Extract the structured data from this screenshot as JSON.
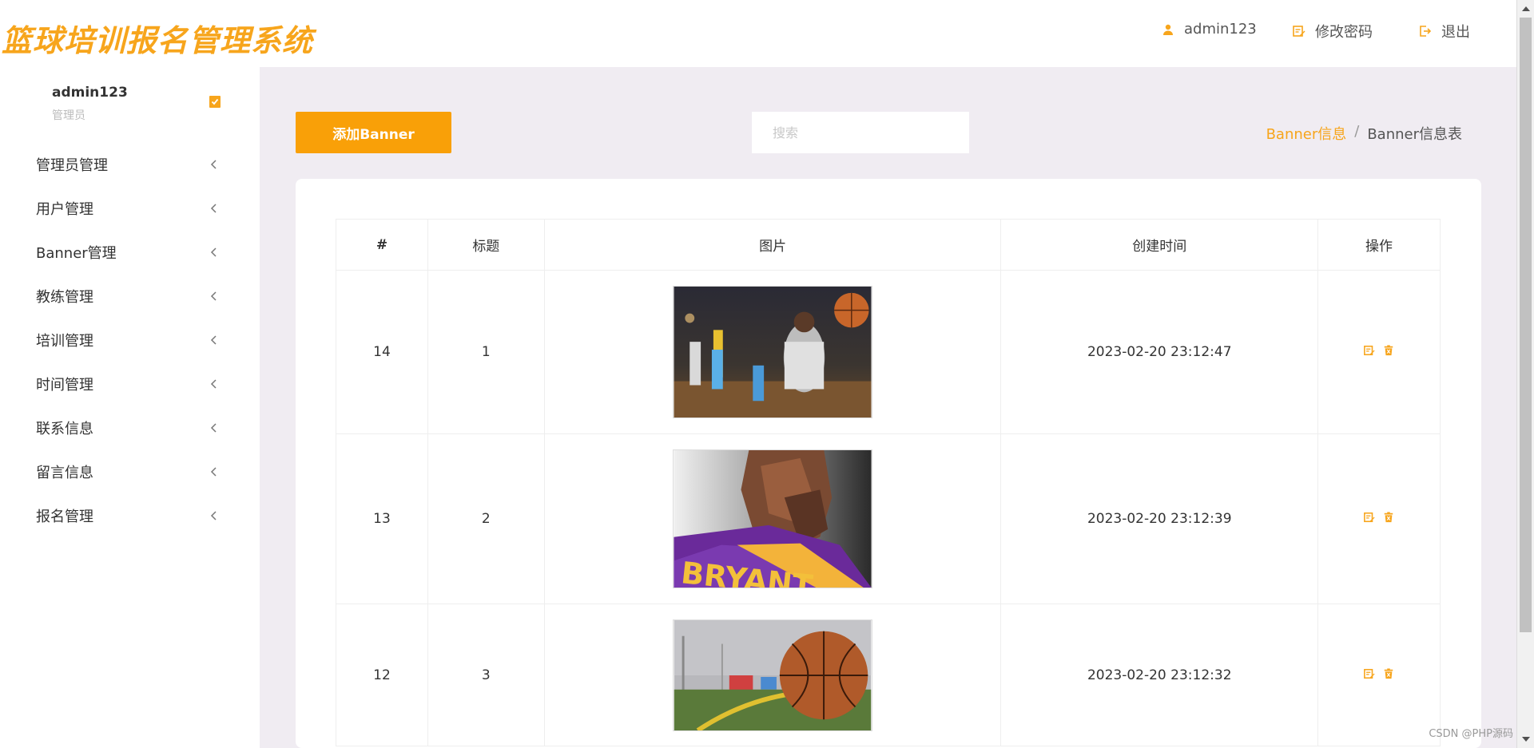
{
  "header": {
    "logo_text": "篮球培训报名管理系统",
    "user_label": "admin123",
    "change_password_label": "修改密码",
    "logout_label": "退出",
    "accent_color": "#f7a51c"
  },
  "sidebar": {
    "user_name": "admin123",
    "user_role": "管理员",
    "items": [
      {
        "label": "管理员管理"
      },
      {
        "label": "用户管理"
      },
      {
        "label": "Banner管理"
      },
      {
        "label": "教练管理"
      },
      {
        "label": "培训管理"
      },
      {
        "label": "时间管理"
      },
      {
        "label": "联系信息"
      },
      {
        "label": "留言信息"
      },
      {
        "label": "报名管理"
      }
    ]
  },
  "toolbar": {
    "add_label": "添加Banner",
    "search_placeholder": "搜索"
  },
  "breadcrumb": {
    "parent": "Banner信息",
    "separator": "/",
    "current": "Banner信息表"
  },
  "table": {
    "headers": [
      "#",
      "标题",
      "图片",
      "创建时间",
      "操作"
    ],
    "rows": [
      {
        "id": "14",
        "title": "1",
        "image": "basketball-player-driving-photo",
        "created": "2023-02-20 23:12:47"
      },
      {
        "id": "13",
        "title": "2",
        "image": "low-poly-bryant-portrait",
        "created": "2023-02-20 23:12:39"
      },
      {
        "id": "12",
        "title": "3",
        "image": "basketball-on-court-photo",
        "created": "2023-02-20 23:12:32"
      }
    ],
    "edit_icon": "edit-icon",
    "delete_icon": "trash-icon"
  },
  "watermark": "CSDN @PHP源码"
}
